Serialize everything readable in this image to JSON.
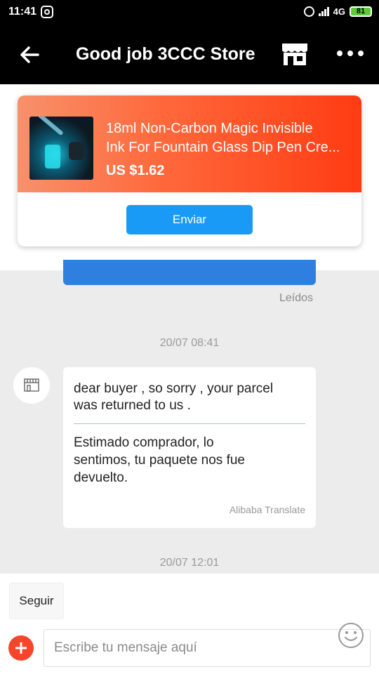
{
  "status": {
    "time": "11:41",
    "network": "4G",
    "battery": "81",
    "icons": [
      "instagram-icon",
      "alarm-icon",
      "signal-icon",
      "battery-icon"
    ]
  },
  "header": {
    "title": "Good job 3CCC Store",
    "icons": [
      "back-arrow-icon",
      "store-icon",
      "more-icon"
    ]
  },
  "product": {
    "title_line1": "18ml Non-Carbon Magic Invisible",
    "title_line2": "Ink For Fountain Glass Dip Pen Cre...",
    "price": "US $1.62",
    "send_label": "Enviar"
  },
  "chat": {
    "read_label": "Leídos",
    "timestamp1": "20/07 08:41",
    "message": {
      "original_line1": "dear buyer , so sorry , your parcel",
      "original_line2": "was returned to us .",
      "translated_line1": "Estimado comprador, lo",
      "translated_line2": "sentimos, tu paquete nos fue",
      "translated_line3": "devuelto.",
      "attribution": "Alibaba Translate"
    },
    "timestamp2": "20/07 12:01"
  },
  "composer": {
    "follow_label": "Seguir",
    "placeholder": "Escribe tu mensaje aquí",
    "icons": [
      "plus-icon",
      "emoji-icon"
    ]
  },
  "colors": {
    "header_bg": "#000000",
    "card_gradient_start": "#f7916c",
    "card_gradient_end": "#ff3b12",
    "send_button": "#1a9af7",
    "sent_bubble": "#2f7fe0",
    "plus_button": "#f5452b"
  }
}
